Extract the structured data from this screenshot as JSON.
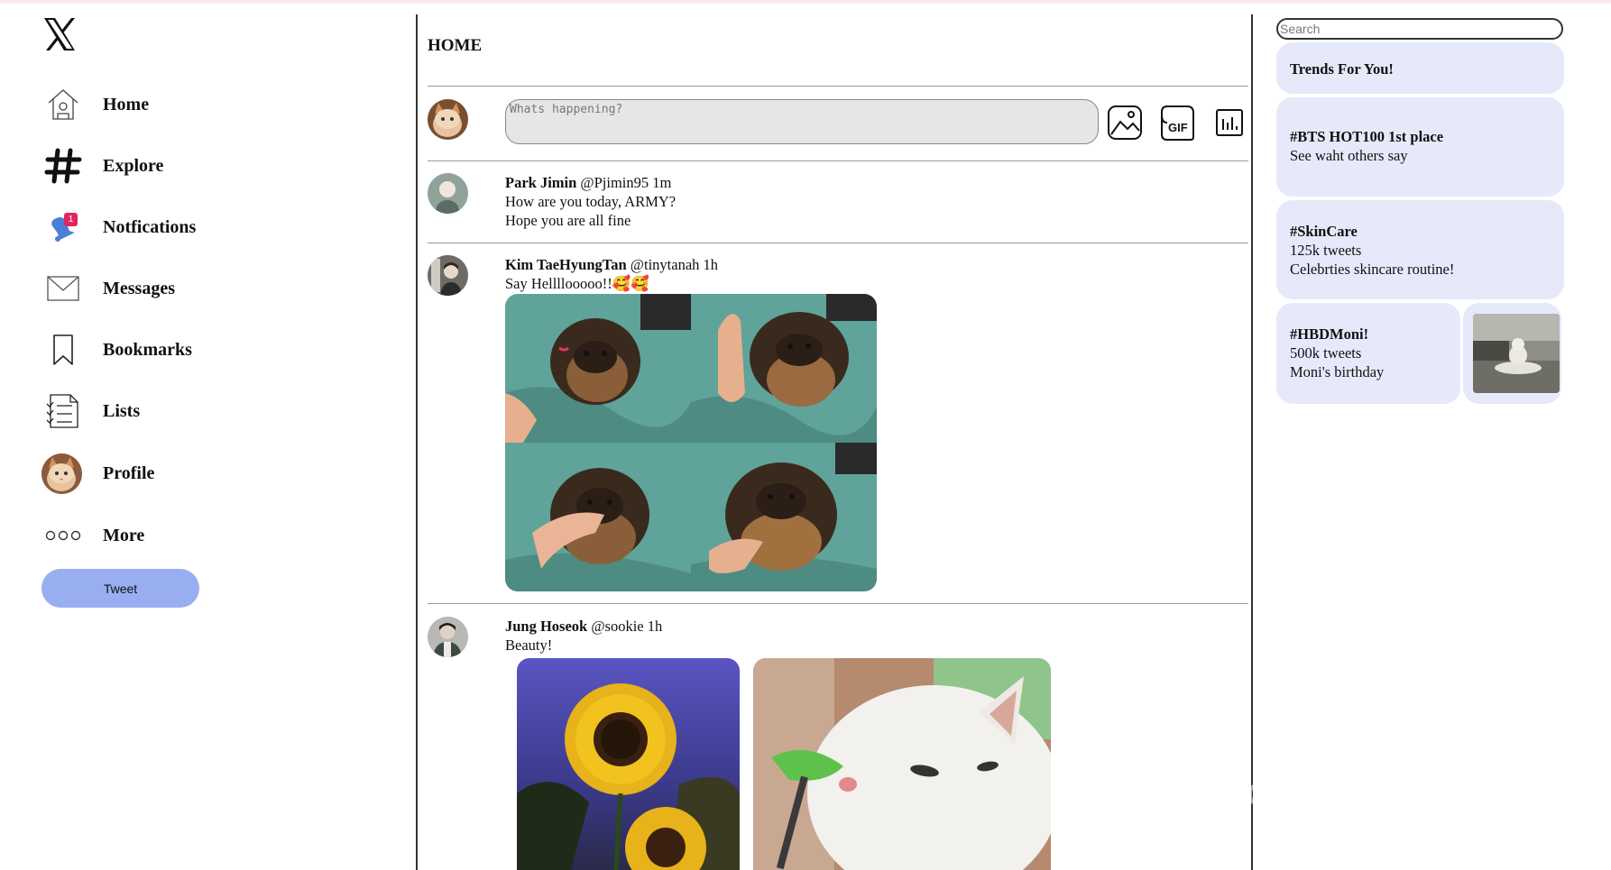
{
  "brand": {
    "logo_glyph": "X"
  },
  "nav": {
    "items": [
      {
        "key": "home",
        "label": "Home",
        "icon": "home-icon"
      },
      {
        "key": "explore",
        "label": "Explore",
        "icon": "hashtag-icon"
      },
      {
        "key": "notifications",
        "label": "Notfications",
        "icon": "bell-icon",
        "badge": "1"
      },
      {
        "key": "messages",
        "label": "Messages",
        "icon": "envelope-icon"
      },
      {
        "key": "bookmarks",
        "label": "Bookmarks",
        "icon": "bookmark-icon"
      },
      {
        "key": "lists",
        "label": "Lists",
        "icon": "list-icon"
      },
      {
        "key": "profile",
        "label": "Profile",
        "icon": "avatar"
      },
      {
        "key": "more",
        "label": "More",
        "icon": "more-dots-icon"
      }
    ],
    "tweet_button": "Tweet"
  },
  "main": {
    "title": "HOME",
    "compose": {
      "placeholder": "Whats happening?",
      "tools": [
        "image-icon",
        "gif-icon",
        "poll-chart-icon"
      ],
      "gif_label": "GIF"
    },
    "posts": [
      {
        "name": "Park Jimin",
        "meta": "@Pjimin95 1m",
        "lines": [
          "How are you today, ARMY?",
          "Hope you are all fine"
        ]
      },
      {
        "name": "Kim TaeHyungTan",
        "meta": "@tinytanah 1h",
        "lines": [
          "Say Hellllooooo!!🥰🥰"
        ]
      },
      {
        "name": "Jung Hoseok",
        "meta": "@sookie 1h",
        "lines": [
          "Beauty!"
        ]
      }
    ],
    "watermark": "mostaql.com"
  },
  "right": {
    "search_placeholder": "Search",
    "trends_header": "Trends For You!",
    "trends": [
      {
        "tag": "#BTS HOT100 1st place",
        "lines": [
          "See waht others say"
        ]
      },
      {
        "tag": "#SkinCare",
        "lines": [
          "125k tweets",
          "Celebrties skincare routine!"
        ]
      },
      {
        "tag": "#HBDMoni!",
        "lines": [
          "500k tweets",
          "Moni's birthday"
        ]
      }
    ]
  },
  "colors": {
    "accent": "#99aef0",
    "trend_bg": "#e5e9fa",
    "badge": "#e0245e",
    "bell": "#4a7fd4"
  }
}
